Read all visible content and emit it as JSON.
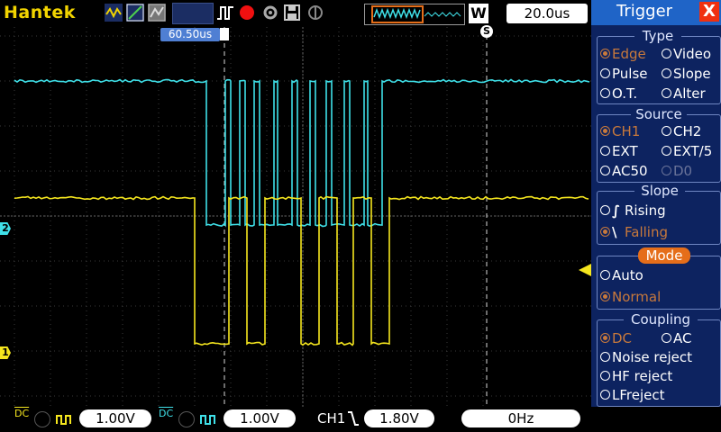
{
  "brand": "Hantek",
  "timebase": "20.0us",
  "window_badge": "W",
  "cursor_time": "60.50us",
  "trigger_marker": "S",
  "panel": {
    "title": "Trigger",
    "close": "X",
    "type": {
      "title": "Type",
      "options": [
        "Edge",
        "Video",
        "Pulse",
        "Slope",
        "O.T.",
        "Alter"
      ],
      "selected": "Edge"
    },
    "source": {
      "title": "Source",
      "options": [
        "CH1",
        "CH2",
        "EXT",
        "EXT/5",
        "AC50",
        "D0"
      ],
      "selected": "CH1"
    },
    "slope": {
      "title": "Slope",
      "rising": "Rising",
      "falling": "Falling",
      "selected": "Falling"
    },
    "mode": {
      "title": "Mode",
      "auto": "Auto",
      "normal": "Normal",
      "selected": "Normal"
    },
    "coupling": {
      "title": "Coupling",
      "options": [
        "DC",
        "AC",
        "Noise reject",
        "HF reject",
        "LFreject"
      ],
      "selected": "DC"
    }
  },
  "bottom": {
    "ch1_scale": "1.00V",
    "ch2_scale": "1.00V",
    "trig_source": "CH1",
    "trig_level": "1.80V",
    "frequency": "0Hz",
    "coupling_label": "DC"
  },
  "channel_markers": {
    "ch1": "1",
    "ch2": "2"
  },
  "colors": {
    "ch1": "#f5e61e",
    "ch2": "#3fe0e8",
    "accent": "#e56e1a",
    "panel": "#0d2360"
  }
}
